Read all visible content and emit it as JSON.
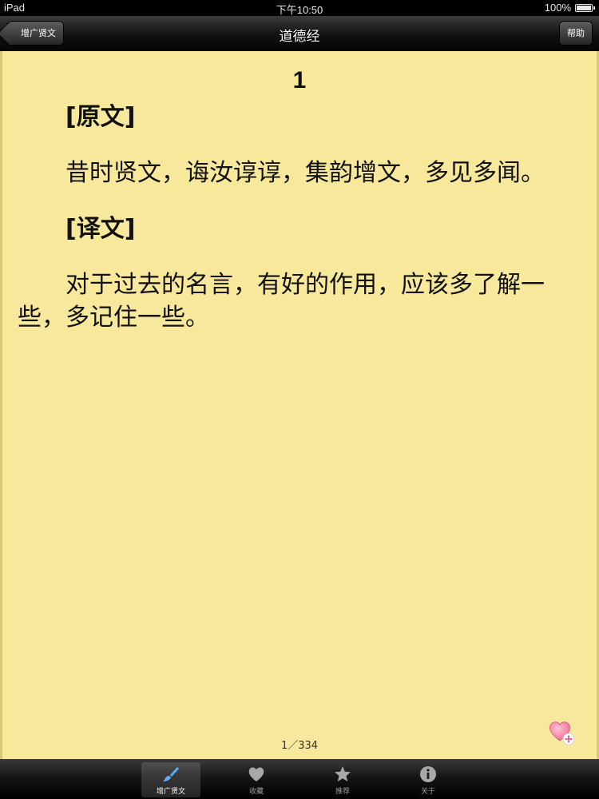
{
  "status_bar": {
    "carrier": "iPad",
    "time": "下午10:50",
    "battery": "100%"
  },
  "nav": {
    "back_label": "增广贤文",
    "title": "道德经",
    "help_label": "帮助"
  },
  "content": {
    "chapter_number": "1",
    "original_heading": "[原文]",
    "original_text": "昔时贤文，诲汝谆谆，集韵增文，多见多闻。",
    "translation_heading": "[译文]",
    "translation_text": "对于过去的名言，有好的作用，应该多了解一些，多记住一些。"
  },
  "pagination": {
    "page": "1／334"
  },
  "tabs": [
    {
      "label": "增广贤文",
      "icon": "brush-icon",
      "active": true
    },
    {
      "label": "收藏",
      "icon": "heart-icon",
      "active": false
    },
    {
      "label": "推荐",
      "icon": "star-icon",
      "active": false
    },
    {
      "label": "关于",
      "icon": "info-icon",
      "active": false
    }
  ],
  "colors": {
    "paper": "#f8e89b",
    "favorite_heart": "#f06a95"
  }
}
